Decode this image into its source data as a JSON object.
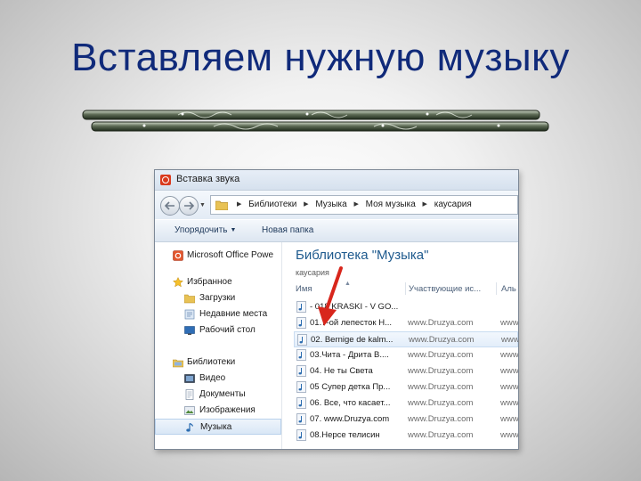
{
  "slide": {
    "title": "Вставляем нужную музыку"
  },
  "dialog": {
    "title": "Вставка звука",
    "breadcrumbs": [
      "Библиотеки",
      "Музыка",
      "Моя музыка",
      "каусария"
    ],
    "toolbar": {
      "organize": "Упорядочить",
      "new_folder": "Новая папка"
    },
    "nav_items": [
      {
        "label": "Microsoft Office Powe",
        "icon": "office-icon"
      },
      {
        "label": "Избранное",
        "icon": "star-icon"
      },
      {
        "label": "Загрузки",
        "icon": "folder-icon"
      },
      {
        "label": "Недавние места",
        "icon": "recent-places-icon"
      },
      {
        "label": "Рабочий стол",
        "icon": "desktop-icon"
      },
      {
        "label": "Библиотеки",
        "icon": "library-icon"
      },
      {
        "label": "Видео",
        "icon": "video-icon"
      },
      {
        "label": "Документы",
        "icon": "documents-icon"
      },
      {
        "label": "Изображения",
        "icon": "pictures-icon"
      },
      {
        "label": "Музыка",
        "icon": "music-icon"
      }
    ],
    "library_title": "Библиотека \"Музыка\"",
    "library_subtitle": "каусария",
    "columns": {
      "name": "Имя",
      "artist": "Участвующие ис...",
      "album": "Аль"
    },
    "files": [
      {
        "name": "- 018 KRASKI - V GO...",
        "artist": "",
        "album": ""
      },
      {
        "name": "01.7-ой лепесток Н...",
        "artist": "www.Druzya.com",
        "album": "www"
      },
      {
        "name": "02. Bernige de kalm...",
        "artist": "www.Druzya.com",
        "album": "www"
      },
      {
        "name": "03.Чита - Дрита В....",
        "artist": "www.Druzya.com",
        "album": "www"
      },
      {
        "name": "04. Не ты Света",
        "artist": "www.Druzya.com",
        "album": "www"
      },
      {
        "name": "05 Супер детка Пр...",
        "artist": "www.Druzya.com",
        "album": "www"
      },
      {
        "name": "06. Все, что касает...",
        "artist": "www.Druzya.com",
        "album": "www"
      },
      {
        "name": "07. www.Druzya.com",
        "artist": "www.Druzya.com",
        "album": "www"
      },
      {
        "name": "08.Нерсе телисин",
        "artist": "www.Druzya.com",
        "album": "www"
      }
    ],
    "hovered_row": 2
  }
}
